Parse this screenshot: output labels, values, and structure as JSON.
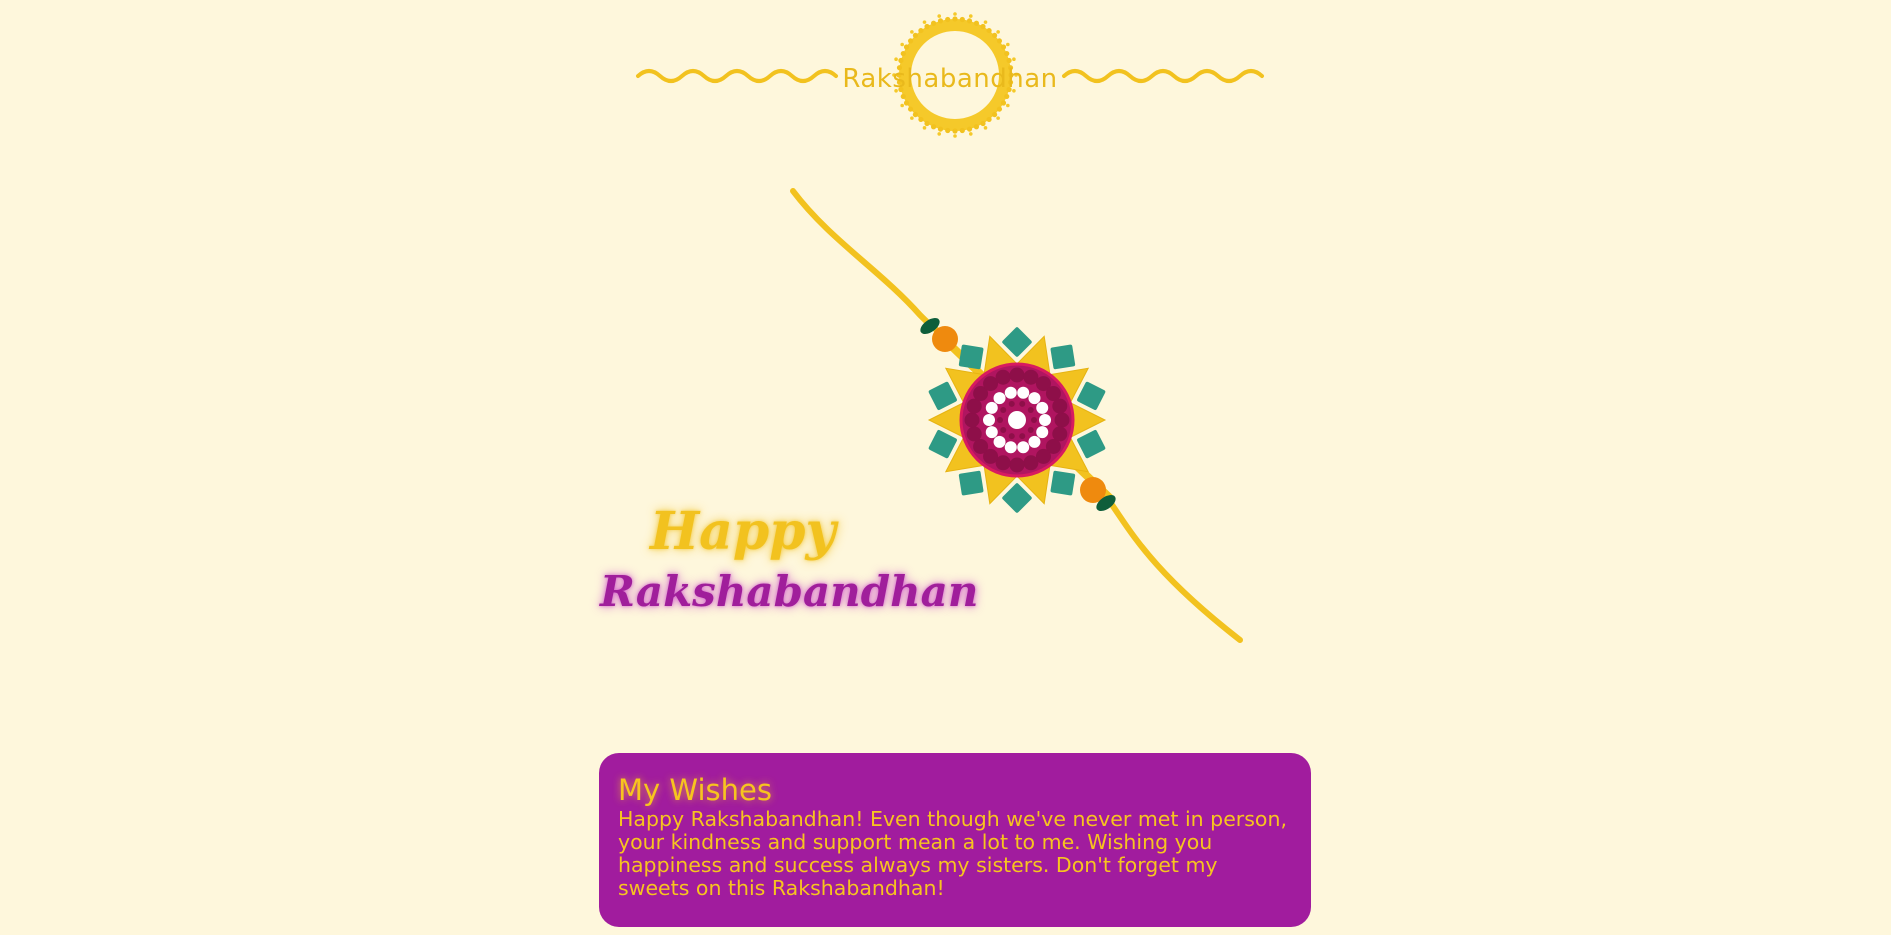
{
  "header": {
    "title": "Rakshabandhan"
  },
  "rakhi": {
    "icon": "rakhi-icon"
  },
  "greeting": {
    "line1": "Happy",
    "line2": "Rakshabandhan"
  },
  "wishes": {
    "title": "My Wishes",
    "message": "Happy Rakshabandhan! Even though we've never met in person, your kindness and support mean a lot to me. Wishing you happiness and success always my sisters. Don't forget my sweets on this Rakshabandhan!"
  },
  "colors": {
    "background": "#fef7dc",
    "gold": "#f2c21f",
    "purple": "#a11c9e",
    "magenta": "#b01560",
    "teal": "#2e9a85",
    "orange": "#ef8a0e",
    "green": "#0e5e3b"
  }
}
